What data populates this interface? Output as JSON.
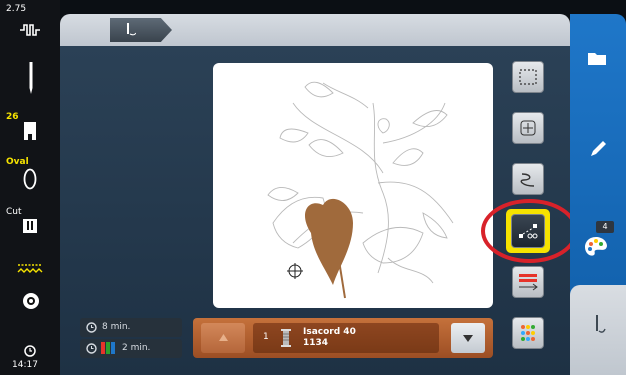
{
  "status": {
    "top_value": "2.75",
    "foot_value": "26",
    "hoop_value": "Oval",
    "cut_label": "Cut",
    "clock": "14:17"
  },
  "times": {
    "total": "8 min.",
    "color": "2 min."
  },
  "thread": {
    "index": "1",
    "brand": "Isacord 40",
    "number": "1134"
  },
  "right_panel": {
    "color_count": "4"
  },
  "colors": {
    "accent_yellow": "#f6e300",
    "leaf_brown": "#a06a3c",
    "right_blue": "#1a6fc0",
    "highlight_red": "#d8222a"
  }
}
